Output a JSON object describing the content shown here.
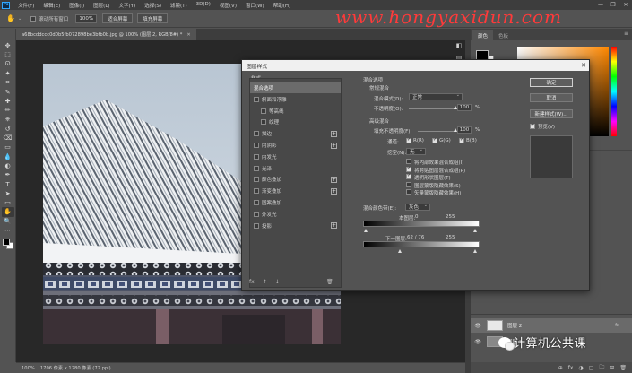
{
  "menu": {
    "logo": "Ps",
    "items": [
      "文件(F)",
      "编辑(E)",
      "图像(I)",
      "图层(L)",
      "文字(Y)",
      "选择(S)",
      "滤镜(T)",
      "3D(D)",
      "视图(V)",
      "窗口(W)",
      "帮助(H)"
    ]
  },
  "window_controls": {
    "minimize": "—",
    "restore": "❐",
    "close": "✕"
  },
  "options": {
    "scroll_all_label": "滚动所有窗口",
    "zoom_value": "100%",
    "fit_screen": "适合屏幕",
    "fill_screen": "填充屏幕"
  },
  "watermark": "www.hongyaxidun.com",
  "document": {
    "tab_title": "a68bcddccc0d0b5fb072898be3bfb0b.jpg @ 100% (图层 2, RGB/8#) *",
    "status_zoom": "100%",
    "status_info": "1706 像素 x 1280 像素 (72 ppi)"
  },
  "tools": [
    "move",
    "marquee",
    "lasso",
    "magic-wand",
    "crop",
    "eyedropper",
    "healing",
    "brush",
    "stamp",
    "history-brush",
    "eraser",
    "gradient",
    "blur",
    "dodge",
    "pen",
    "type",
    "path-select",
    "shape",
    "hand",
    "zoom",
    "more"
  ],
  "tool_glyphs": [
    "✥",
    "⬚",
    "ᘏ",
    "✦",
    "⌗",
    "✎",
    "✚",
    "✏",
    "⎈",
    "↺",
    "⌫",
    "▭",
    "💧",
    "◐",
    "✒",
    "T",
    "➤",
    "▭",
    "✋",
    "🔍",
    "⋯"
  ],
  "right_panel": {
    "tabs": [
      "颜色",
      "色板"
    ],
    "icon_glyphs": [
      "◧",
      "▤"
    ]
  },
  "layers": {
    "rows": [
      {
        "name": "图层 2",
        "fx": "fx",
        "thumb": "#e8e8e8"
      },
      {
        "name": "图层 1",
        "thumb": "#888888"
      }
    ],
    "bottom_icons": [
      "⊕",
      "fx",
      "◑",
      "▢",
      "🗀",
      "⊞",
      "🗑"
    ]
  },
  "brand": "计算机公共课",
  "dialog": {
    "title": "图层样式",
    "close": "✕",
    "styles_header": "样式",
    "styles": [
      {
        "label": "混合选项",
        "checkbox": false,
        "plus": false,
        "indent": false,
        "selected": true
      },
      {
        "label": "斜面和浮雕",
        "checkbox": true,
        "plus": false,
        "indent": false
      },
      {
        "label": "等高线",
        "checkbox": true,
        "plus": false,
        "indent": true
      },
      {
        "label": "纹理",
        "checkbox": true,
        "plus": false,
        "indent": true
      },
      {
        "label": "描边",
        "checkbox": true,
        "plus": true,
        "indent": false
      },
      {
        "label": "内阴影",
        "checkbox": true,
        "plus": true,
        "indent": false
      },
      {
        "label": "内发光",
        "checkbox": true,
        "plus": false,
        "indent": false
      },
      {
        "label": "光泽",
        "checkbox": true,
        "plus": false,
        "indent": false
      },
      {
        "label": "颜色叠加",
        "checkbox": true,
        "plus": true,
        "indent": false
      },
      {
        "label": "渐变叠加",
        "checkbox": true,
        "plus": true,
        "indent": false
      },
      {
        "label": "图案叠加",
        "checkbox": true,
        "plus": false,
        "indent": false
      },
      {
        "label": "外发光",
        "checkbox": true,
        "plus": false,
        "indent": false
      },
      {
        "label": "投影",
        "checkbox": true,
        "plus": true,
        "indent": false
      }
    ],
    "footer": {
      "fx": "fx",
      "up": "↑",
      "down": "↓",
      "trash": "🗑"
    },
    "blend": {
      "section": "混合选项",
      "general": "常规混合",
      "mode_label": "混合模式(D):",
      "mode_value": "正常",
      "opacity_label": "不透明度(O):",
      "opacity_value": "100",
      "opacity_fraction": 1.0,
      "advanced": "高级混合",
      "fill_label": "填充不透明度(F):",
      "fill_value": "100",
      "fill_fraction": 1.0,
      "percent": "%",
      "channels_label": "通道:",
      "channels": [
        "R(R)",
        "G(G)",
        "B(B)"
      ],
      "knockout_label": "挖空(N):",
      "knockout_value": "无",
      "options": [
        {
          "label": "将内部效果混合成组(I)",
          "checked": false
        },
        {
          "label": "将剪贴图层混合成组(P)",
          "checked": true
        },
        {
          "label": "透明形状图层(T)",
          "checked": true
        },
        {
          "label": "图层蒙版隐藏效果(S)",
          "checked": false
        },
        {
          "label": "矢量蒙版隐藏效果(H)",
          "checked": false
        }
      ],
      "blend_if_label": "混合颜色带(E):",
      "blend_if_value": "灰色",
      "this_layer_label": "本图层:",
      "this_layer_low": "0",
      "this_layer_high": "255",
      "under_label": "下一图层:",
      "under_value": "62  /  76",
      "under_high": "255"
    },
    "buttons": {
      "ok": "确定",
      "cancel": "取消",
      "new_style": "新建样式(W)...",
      "preview": "预览(V)"
    }
  }
}
